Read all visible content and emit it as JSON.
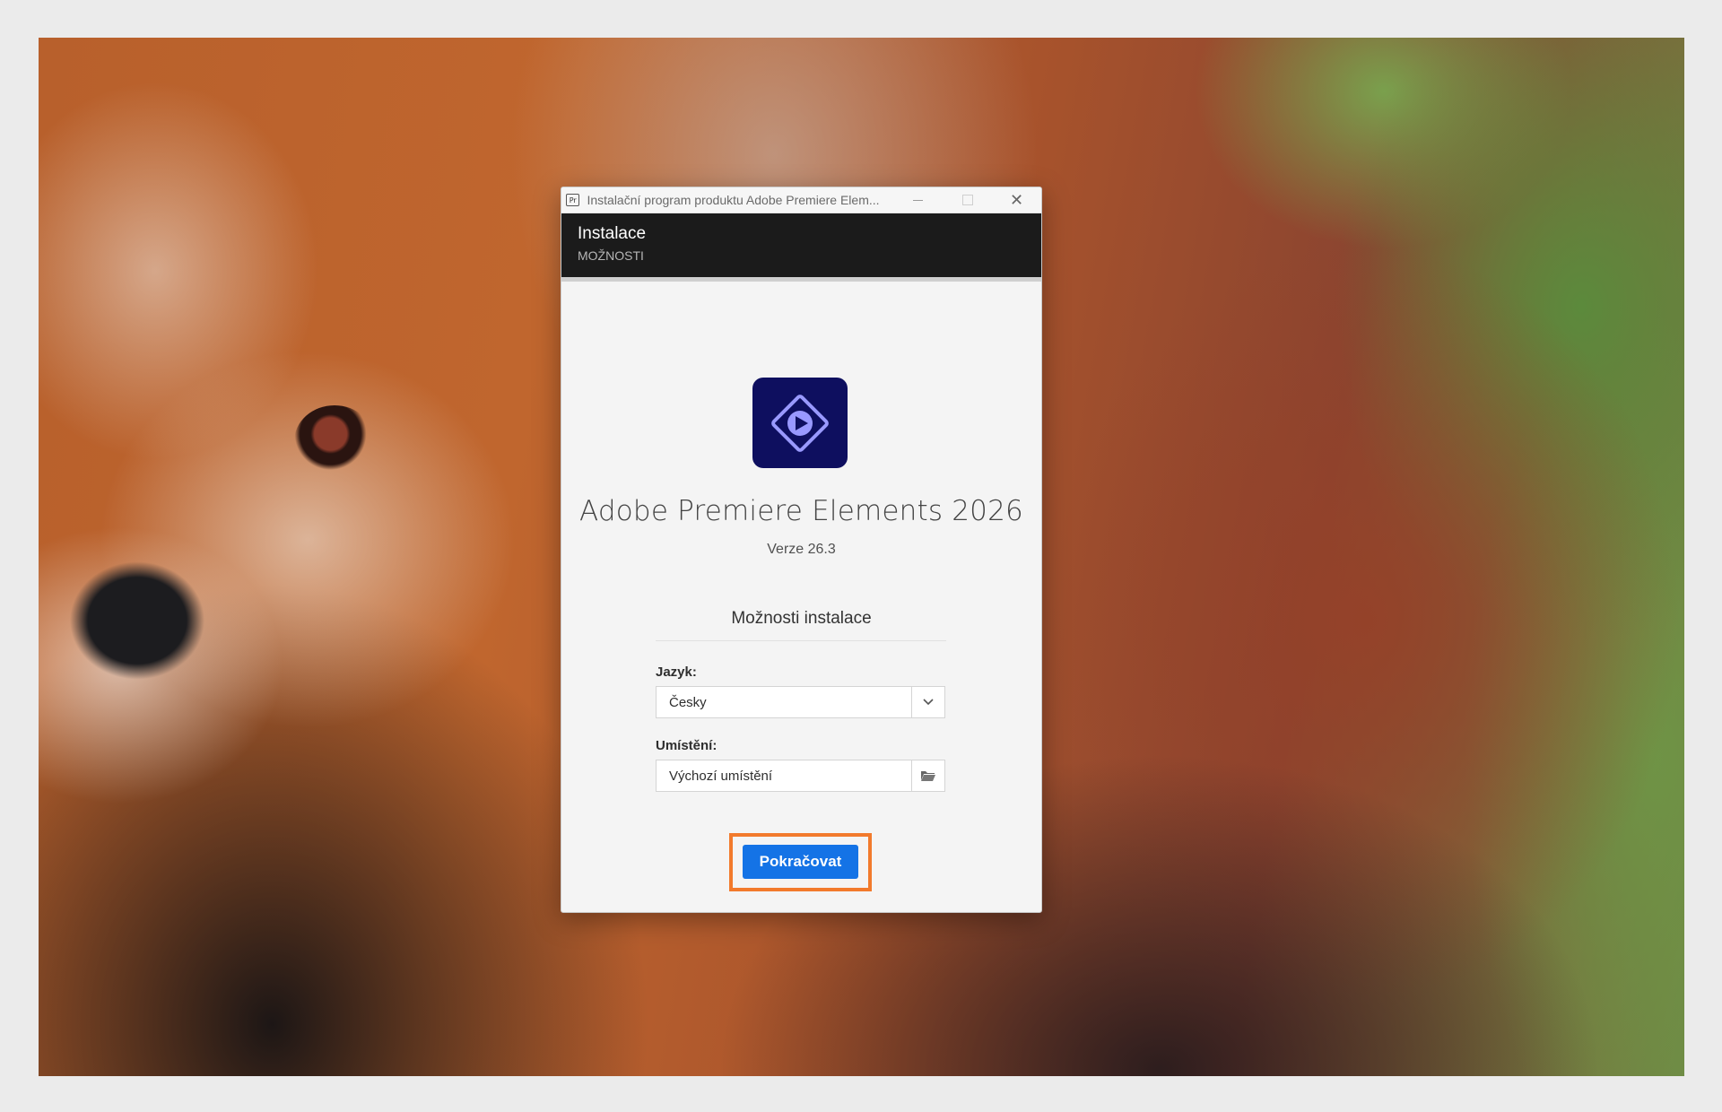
{
  "window": {
    "title": "Instalační program produktu Adobe Premiere Elem...",
    "mini_icon": "Pr",
    "close_glyph": "✕"
  },
  "header": {
    "title": "Instalace",
    "subtitle": "MOŽNOSTI"
  },
  "product": {
    "icon": "premiere-elements-play-icon",
    "name": "Adobe Premiere Elements 2026",
    "version": "Verze 26.3"
  },
  "options": {
    "title": "Možnosti instalace",
    "language_label": "Jazyk:",
    "language_value": "Česky",
    "location_label": "Umístění:",
    "location_value": "Výchozí umístění"
  },
  "actions": {
    "continue_label": "Pokračovat"
  },
  "colors": {
    "accent": "#1473e6",
    "highlight": "#f27a2c",
    "logo_bg": "#0e0f5f",
    "logo_fg": "#9999ff"
  }
}
